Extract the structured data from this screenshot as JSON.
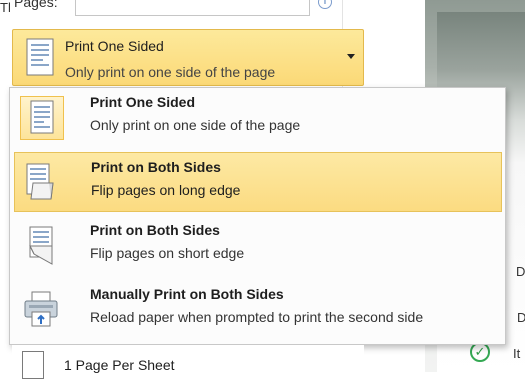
{
  "pages": {
    "label": "Pages:"
  },
  "selector": {
    "title": "Print One Sided",
    "subtitle": "Only print on one side of the page"
  },
  "menu": {
    "items": [
      {
        "title": "Print One Sided",
        "subtitle": "Only print on one side of the page",
        "icon": "one-sided-page-icon"
      },
      {
        "title": "Print on Both Sides",
        "subtitle": "Flip pages on long edge",
        "icon": "flip-long-edge-icon"
      },
      {
        "title": "Print on Both Sides",
        "subtitle": "Flip pages on short edge",
        "icon": "flip-short-edge-icon"
      },
      {
        "title": "Manually Print on Both Sides",
        "subtitle": "Reload paper when prompted to print the second side",
        "icon": "manual-duplex-printer-icon"
      }
    ]
  },
  "below_menu": {
    "label": "1 Page Per Sheet"
  },
  "preview": {
    "heading_fragment": "Tl",
    "line1": "DF",
    "line2": "D",
    "line3": "It"
  },
  "colors": {
    "highlight": "#fbdb81",
    "highlight_border": "#e3b94c",
    "check_green": "#34a853"
  }
}
